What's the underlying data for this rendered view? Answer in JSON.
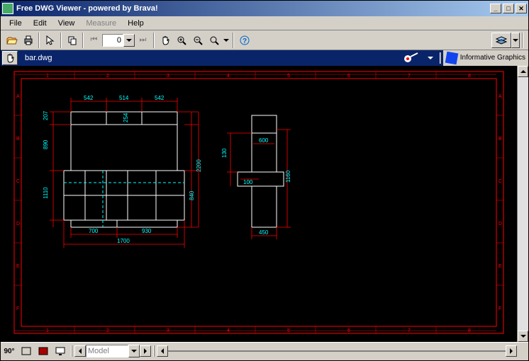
{
  "title": "Free DWG Viewer - powered by Brava!",
  "menus": [
    "File",
    "Edit",
    "View",
    "Measure",
    "Help"
  ],
  "menus_disabled": [
    false,
    false,
    false,
    true,
    false
  ],
  "page_number": "0",
  "file_tab": "bar.dwg",
  "corporate": "Informative\nGraphics",
  "model_tab": "Model",
  "rotate_label": "90°",
  "dims_left": {
    "top_row": [
      "542",
      "514",
      "542"
    ],
    "left_col": [
      "207",
      "890",
      "1110"
    ],
    "right_col": [
      "254",
      "2200",
      "840"
    ],
    "bottom_row": [
      "700",
      "930"
    ],
    "bottom_total": "1700"
  },
  "dims_right": {
    "left_col": [
      "130"
    ],
    "inside": [
      "600",
      "100"
    ],
    "right_col": [
      "1160"
    ],
    "bottom": "450"
  },
  "frame_cols": [
    "1",
    "2",
    "3",
    "4",
    "5",
    "6",
    "7",
    "8"
  ],
  "frame_rows": [
    "A",
    "B",
    "C",
    "D",
    "E",
    "F"
  ]
}
